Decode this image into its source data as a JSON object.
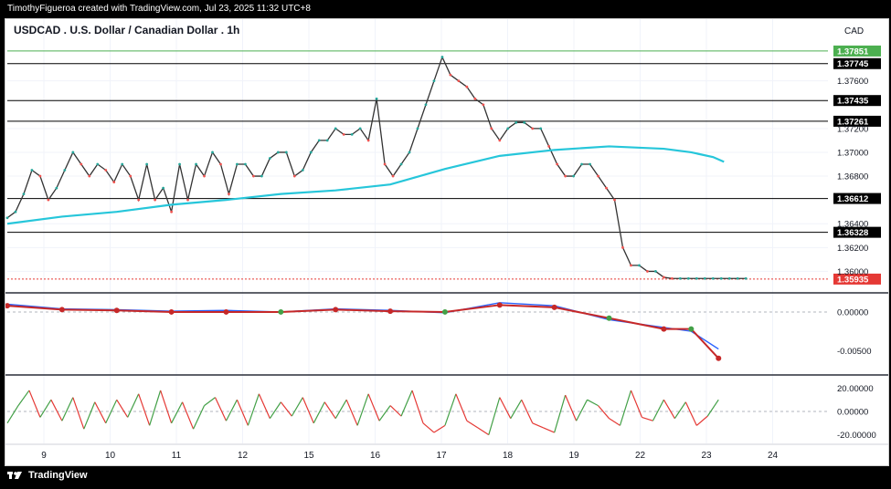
{
  "header": {
    "caption": "TimothyFigueroa created with TradingView.com, Jul 23, 2025 11:32 UTC+8",
    "symbol_title": "USDCAD . U.S. Dollar / Canadian Dollar . 1h",
    "currency": "CAD"
  },
  "footer": {
    "brand": "TradingView"
  },
  "chart_data": [
    {
      "type": "line",
      "title": "USDCAD . U.S. Dollar / Canadian Dollar . 1h",
      "ylim": [
        1.3585,
        1.3795
      ],
      "y_ticks": [
        "1.37600",
        "1.37200",
        "1.37000",
        "1.36800",
        "1.36400",
        "1.36200",
        "1.36000"
      ],
      "x_tick_labels": [
        "9",
        "10",
        "11",
        "12",
        "15",
        "16",
        "17",
        "18",
        "19",
        "22",
        "23",
        "24"
      ],
      "horizontal_levels": [
        {
          "value": 1.37851,
          "label": "1.37851",
          "color": "#4caf50"
        },
        {
          "value": 1.37745,
          "label": "1.37745",
          "color": "#000000"
        },
        {
          "value": 1.37435,
          "label": "1.37435",
          "color": "#000000"
        },
        {
          "value": 1.37261,
          "label": "1.37261",
          "color": "#000000"
        },
        {
          "value": 1.36612,
          "label": "1.36612",
          "color": "#000000"
        },
        {
          "value": 1.36328,
          "label": "1.36328",
          "color": "#000000"
        }
      ],
      "current_price": {
        "value": 1.35935,
        "label": "1.35935",
        "color": "#e53935"
      },
      "series": [
        {
          "kind": "close",
          "color": "#333333",
          "x": [
            0,
            3,
            6,
            9,
            12,
            15,
            18,
            21,
            24,
            27,
            30,
            33,
            36,
            39,
            42,
            45,
            48,
            51,
            54,
            57,
            60,
            63,
            66,
            69,
            72,
            75,
            78,
            81,
            84,
            87,
            90,
            93,
            96,
            99,
            102,
            105,
            108,
            111,
            114,
            117,
            120,
            123,
            126,
            129,
            132,
            135,
            138,
            141,
            144,
            147,
            150,
            153,
            156,
            159,
            162,
            165,
            168,
            171,
            174,
            177,
            180,
            183,
            186,
            189,
            192,
            195,
            198,
            201,
            204,
            207,
            210,
            213,
            216,
            219,
            222,
            225,
            228,
            231,
            234,
            237,
            240,
            243,
            246,
            249,
            252,
            255,
            258,
            261,
            264,
            267,
            270
          ],
          "y": [
            1.3645,
            1.365,
            1.3665,
            1.3685,
            1.368,
            1.366,
            1.367,
            1.3685,
            1.37,
            1.369,
            1.368,
            1.369,
            1.3685,
            1.3675,
            1.369,
            1.368,
            1.366,
            1.369,
            1.366,
            1.367,
            1.365,
            1.369,
            1.366,
            1.369,
            1.368,
            1.37,
            1.369,
            1.3665,
            1.369,
            1.369,
            1.368,
            1.368,
            1.3695,
            1.37,
            1.37,
            1.368,
            1.3685,
            1.37,
            1.371,
            1.371,
            1.372,
            1.3715,
            1.3715,
            1.372,
            1.371,
            1.3745,
            1.369,
            1.368,
            1.369,
            1.37,
            1.372,
            1.374,
            1.376,
            1.378,
            1.3765,
            1.376,
            1.3755,
            1.3745,
            1.374,
            1.372,
            1.371,
            1.372,
            1.3725,
            1.3725,
            1.372,
            1.372,
            1.3705,
            1.369,
            1.368,
            1.368,
            1.369,
            1.369,
            1.368,
            1.367,
            1.366,
            1.362,
            1.3605,
            1.3605,
            1.36,
            1.36,
            1.3595,
            1.3594,
            1.3594,
            1.3594,
            1.3594,
            1.3594,
            1.3594,
            1.3594,
            1.3594,
            1.3594,
            1.3594
          ]
        },
        {
          "kind": "moving_average",
          "color": "#26c6da",
          "x": [
            0,
            20,
            40,
            60,
            80,
            100,
            120,
            140,
            160,
            180,
            200,
            220,
            240,
            250,
            258,
            262
          ],
          "y": [
            1.364,
            1.3646,
            1.365,
            1.3656,
            1.366,
            1.3665,
            1.3668,
            1.3673,
            1.3686,
            1.3697,
            1.3702,
            1.3705,
            1.3703,
            1.37,
            1.3696,
            1.3692
          ]
        }
      ]
    },
    {
      "type": "line",
      "title": "",
      "ylim": [
        -0.0065,
        0.002
      ],
      "y_ticks": [
        "0.00000",
        "-0.00500"
      ],
      "series": [
        {
          "kind": "fast",
          "color": "#2962ff",
          "x": [
            0,
            20,
            40,
            60,
            80,
            100,
            120,
            140,
            160,
            180,
            200,
            220,
            240,
            250,
            260
          ],
          "y": [
            0.001,
            0.0004,
            0.0003,
            0.0001,
            0.0002,
            0.0,
            0.0004,
            0.0002,
            -0.0001,
            0.0012,
            0.0008,
            -0.001,
            -0.002,
            -0.0025,
            -0.0048
          ]
        },
        {
          "kind": "slow",
          "color": "#c62828",
          "x": [
            0,
            20,
            40,
            60,
            80,
            100,
            120,
            140,
            160,
            180,
            200,
            220,
            240,
            250,
            260
          ],
          "y": [
            0.0008,
            0.0003,
            0.0002,
            0.0,
            0.0,
            0.0,
            0.0003,
            0.0001,
            0.0,
            0.0009,
            0.0006,
            -0.0008,
            -0.0022,
            -0.0022,
            -0.006
          ]
        }
      ]
    },
    {
      "type": "line",
      "title": "",
      "ylim": [
        -25,
        25
      ],
      "y_ticks": [
        "20.00000",
        "0.00000",
        "-20.00000"
      ],
      "series": [
        {
          "kind": "oscillator",
          "color": "#43a047",
          "x": [
            0,
            4,
            8,
            12,
            16,
            20,
            24,
            28,
            32,
            36,
            40,
            44,
            48,
            52,
            56,
            60,
            64,
            68,
            72,
            76,
            80,
            84,
            88,
            92,
            96,
            100,
            104,
            108,
            112,
            116,
            120,
            124,
            128,
            132,
            136,
            140,
            144,
            148,
            152,
            156,
            160,
            164,
            168,
            172,
            176,
            180,
            184,
            188,
            192,
            196,
            200,
            204,
            208,
            212,
            216,
            220,
            224,
            228,
            232,
            236,
            240,
            244,
            248,
            252,
            256,
            260
          ],
          "y": [
            -10,
            5,
            18,
            -5,
            10,
            -8,
            12,
            -15,
            8,
            -10,
            10,
            -5,
            15,
            -12,
            18,
            -10,
            8,
            -15,
            5,
            12,
            -8,
            10,
            -12,
            15,
            -6,
            8,
            -4,
            12,
            -10,
            8,
            -6,
            10,
            -12,
            15,
            -8,
            5,
            -4,
            18,
            -10,
            -18,
            -12,
            15,
            -8,
            -14,
            -20,
            12,
            -6,
            10,
            -10,
            -14,
            -18,
            14,
            -8,
            10,
            5,
            -6,
            -12,
            18,
            -5,
            -8,
            10,
            -6,
            8,
            -12,
            -4,
            10
          ]
        }
      ]
    }
  ]
}
